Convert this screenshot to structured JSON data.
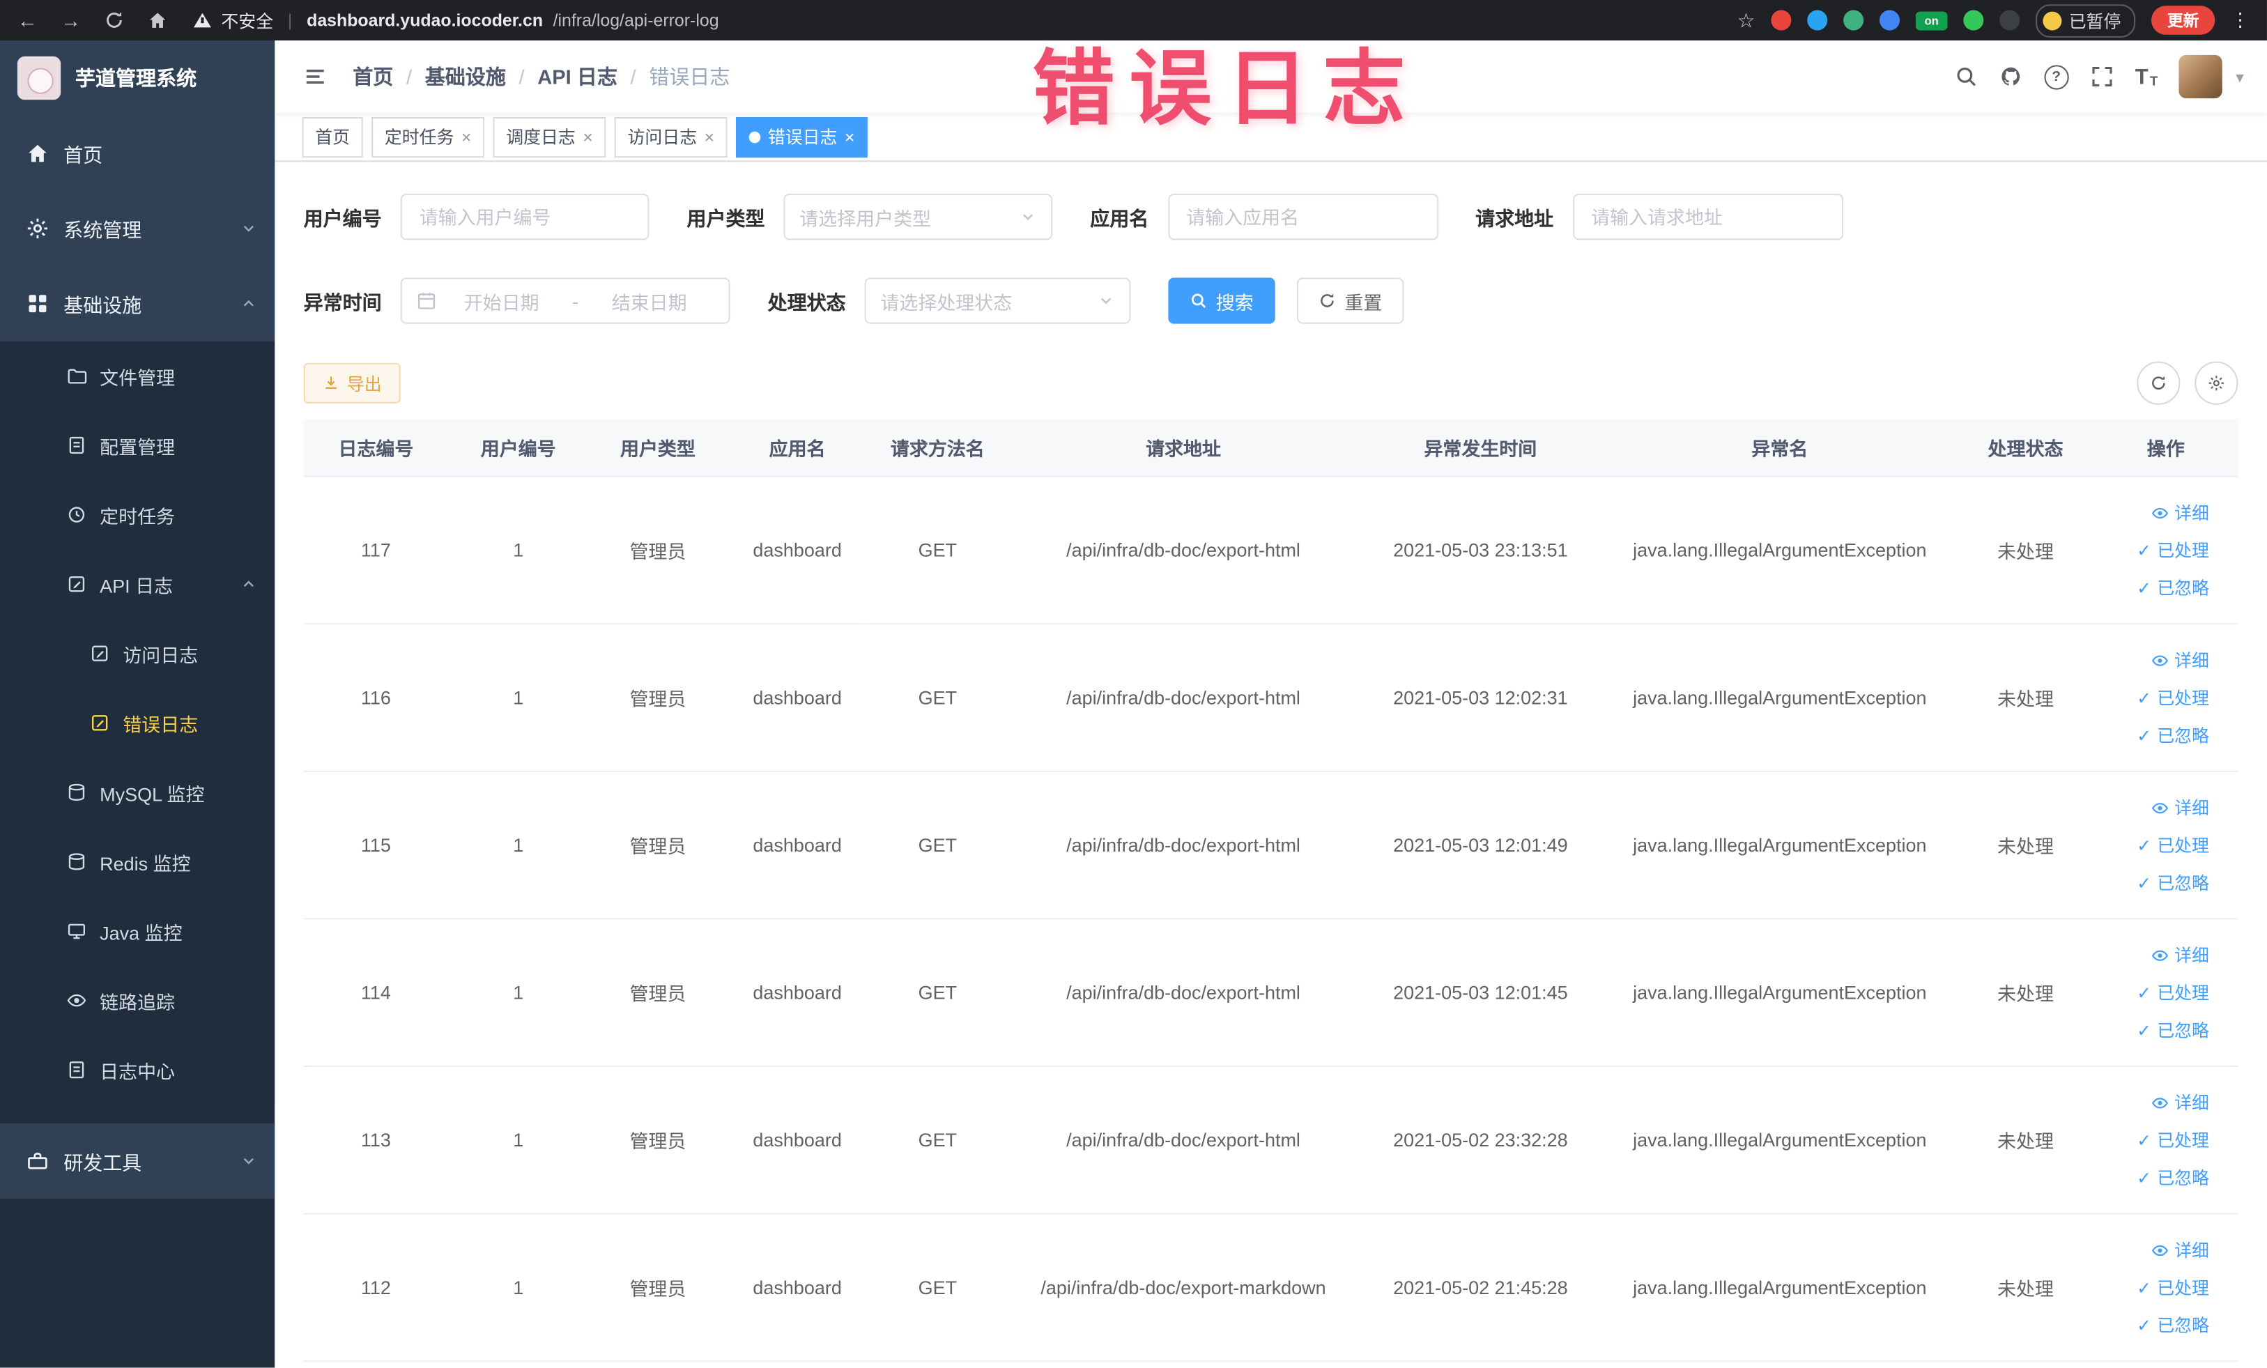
{
  "glyphs": {
    "back": "←",
    "forward": "→",
    "star": "☆",
    "menu_dots": "⋮",
    "breadcrumb_sep": "/",
    "caret": "▾",
    "close": "×",
    "check": "✓",
    "question": "?",
    "font_icon_large": "T",
    "font_icon_small": "T"
  },
  "browser": {
    "security_label": "不安全",
    "url_domain": "dashboard.yudao.iocoder.cn",
    "url_path": "/infra/log/api-error-log",
    "on_badge": "on",
    "paused_badge": "已暂停",
    "update_button": "更新",
    "extension_colors": [
      "#e8453c",
      "#2aa3f1",
      "#3fb27f",
      "#4285f4",
      "#12a150",
      "#35c759",
      "#3c4043"
    ]
  },
  "annotation": {
    "text": "错误日志"
  },
  "sidebar": {
    "logo_title": "芋道管理系统",
    "home": "首页",
    "system": "系统管理",
    "infra": "基础设施",
    "infra_children": [
      "文件管理",
      "配置管理",
      "定时任务",
      "API 日志",
      "MySQL 监控",
      "Redis 监控",
      "Java 监控",
      "链路追踪",
      "日志中心"
    ],
    "api_children": [
      "访问日志",
      "错误日志"
    ],
    "dev": "研发工具"
  },
  "header": {
    "breadcrumb": [
      "首页",
      "基础设施",
      "API 日志",
      "错误日志"
    ]
  },
  "tabs": [
    "首页",
    "定时任务",
    "调度日志",
    "访问日志",
    "错误日志"
  ],
  "filters": {
    "user_id": {
      "label": "用户编号",
      "placeholder": "请输入用户编号"
    },
    "user_type": {
      "label": "用户类型",
      "placeholder": "请选择用户类型"
    },
    "app_name": {
      "label": "应用名",
      "placeholder": "请输入应用名"
    },
    "request_url": {
      "label": "请求地址",
      "placeholder": "请输入请求地址"
    },
    "exception_time": {
      "label": "异常时间",
      "start_placeholder": "开始日期",
      "separator": "-",
      "end_placeholder": "结束日期"
    },
    "process_status": {
      "label": "处理状态",
      "placeholder": "请选择处理状态"
    },
    "search_button": "搜索",
    "reset_button": "重置"
  },
  "toolbar": {
    "export_button": "导出"
  },
  "table": {
    "columns": [
      "日志编号",
      "用户编号",
      "用户类型",
      "应用名",
      "请求方法名",
      "请求地址",
      "异常发生时间",
      "异常名",
      "处理状态",
      "操作"
    ],
    "actions": {
      "detail": "详细",
      "processed": "已处理",
      "ignored": "已忽略"
    },
    "rows": [
      {
        "id": "117",
        "user_id": "1",
        "user_type": "管理员",
        "app_name": "dashboard",
        "method": "GET",
        "url": "/api/infra/db-doc/export-html",
        "time": "2021-05-03 23:13:51",
        "exception": "java.lang.IllegalArgumentException",
        "status": "未处理"
      },
      {
        "id": "116",
        "user_id": "1",
        "user_type": "管理员",
        "app_name": "dashboard",
        "method": "GET",
        "url": "/api/infra/db-doc/export-html",
        "time": "2021-05-03 12:02:31",
        "exception": "java.lang.IllegalArgumentException",
        "status": "未处理"
      },
      {
        "id": "115",
        "user_id": "1",
        "user_type": "管理员",
        "app_name": "dashboard",
        "method": "GET",
        "url": "/api/infra/db-doc/export-html",
        "time": "2021-05-03 12:01:49",
        "exception": "java.lang.IllegalArgumentException",
        "status": "未处理"
      },
      {
        "id": "114",
        "user_id": "1",
        "user_type": "管理员",
        "app_name": "dashboard",
        "method": "GET",
        "url": "/api/infra/db-doc/export-html",
        "time": "2021-05-03 12:01:45",
        "exception": "java.lang.IllegalArgumentException",
        "status": "未处理"
      },
      {
        "id": "113",
        "user_id": "1",
        "user_type": "管理员",
        "app_name": "dashboard",
        "method": "GET",
        "url": "/api/infra/db-doc/export-html",
        "time": "2021-05-02 23:32:28",
        "exception": "java.lang.IllegalArgumentException",
        "status": "未处理"
      },
      {
        "id": "112",
        "user_id": "1",
        "user_type": "管理员",
        "app_name": "dashboard",
        "method": "GET",
        "url": "/api/infra/db-doc/export-markdown",
        "time": "2021-05-02 21:45:28",
        "exception": "java.lang.IllegalArgumentException",
        "status": "未处理"
      }
    ]
  },
  "colors": {
    "primary": "#409eff",
    "warning": "#e6a23c",
    "sidebar_active": "#ffd04b",
    "annotation": "#ee3b5f"
  }
}
